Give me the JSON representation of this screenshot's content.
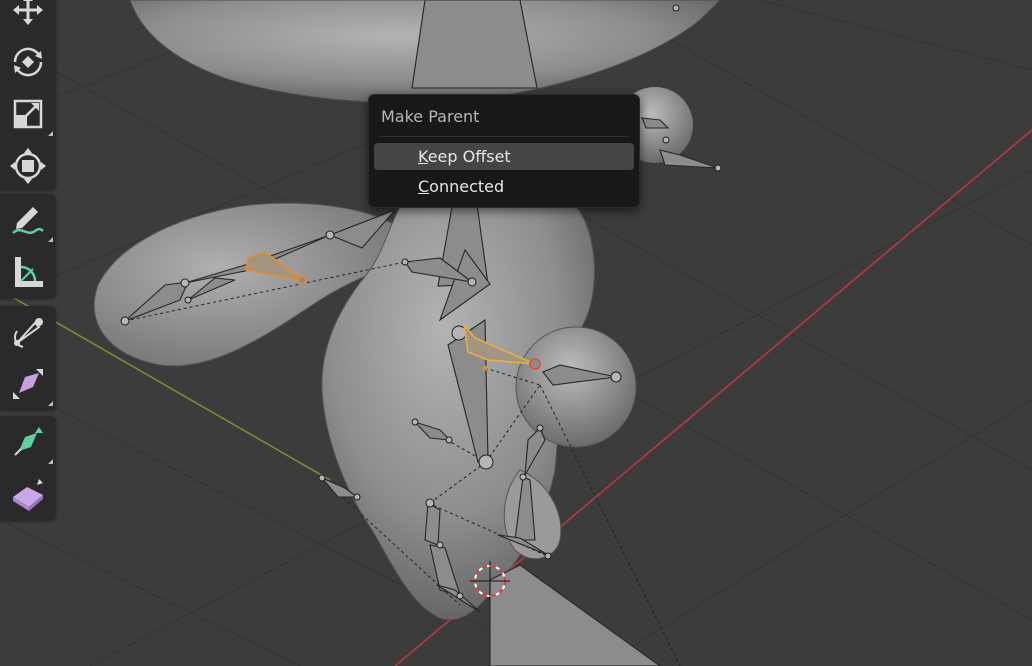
{
  "viewport": {
    "background": "#3c3c3c",
    "grid_color": "#353535",
    "x_axis_color": "#b8383f",
    "y_axis_color": "#6f9130",
    "mesh_color": "#8f8f8f",
    "bone_color": "#8c8c8c",
    "selected_bone_color": "#e88c2b"
  },
  "toolbar": {
    "groups": [
      {
        "tools": [
          {
            "name": "move-tool",
            "icon": "move-icon"
          },
          {
            "name": "rotate-tool",
            "icon": "rotate-icon"
          },
          {
            "name": "scale-tool",
            "icon": "scale-icon"
          },
          {
            "name": "transform-tool",
            "icon": "transform-icon"
          }
        ]
      },
      {
        "tools": [
          {
            "name": "annotate-tool",
            "icon": "annotate-icon"
          },
          {
            "name": "measure-tool",
            "icon": "measure-icon"
          }
        ]
      },
      {
        "tools": [
          {
            "name": "roll-tool",
            "icon": "bone-roll-icon"
          },
          {
            "name": "bone-size-tool",
            "icon": "bone-size-icon"
          }
        ]
      },
      {
        "tools": [
          {
            "name": "extrude-tool",
            "icon": "extrude-icon"
          },
          {
            "name": "shear-tool",
            "icon": "shear-icon"
          }
        ]
      }
    ]
  },
  "popup": {
    "title": "Make Parent",
    "items": [
      {
        "accel": "K",
        "rest": "eep Offset",
        "highlighted": true
      },
      {
        "accel": "C",
        "rest": "onnected",
        "highlighted": false
      }
    ]
  }
}
